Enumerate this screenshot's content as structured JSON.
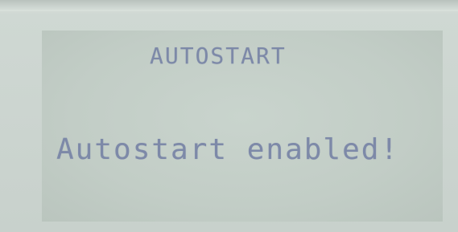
{
  "display": {
    "title": "AUTOSTART",
    "message": "Autostart enabled!",
    "text_color": "#7d89a8",
    "background_color": "#c3ccc6"
  }
}
